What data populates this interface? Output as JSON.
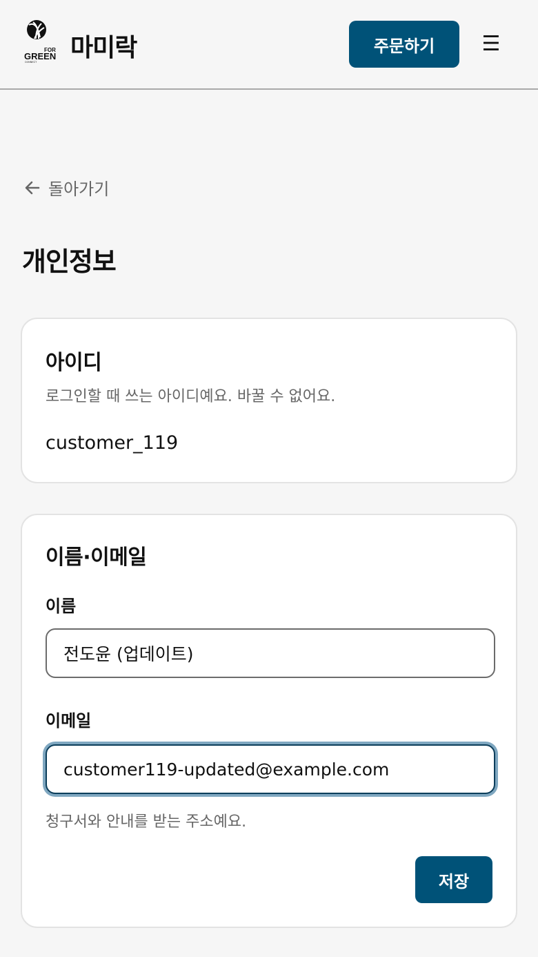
{
  "header": {
    "logo_text_for": "FOR",
    "logo_text_green": "GREEN",
    "logo_text_connect": "CONNECT",
    "brand_name": "마미락",
    "order_button_label": "주문하기",
    "menu_icon": "hamburger-menu-icon"
  },
  "nav": {
    "back_label": "돌아가기",
    "back_icon": "arrow-left-icon"
  },
  "page": {
    "title": "개인정보"
  },
  "id_card": {
    "title": "아이디",
    "description": "로그인할 때 쓰는 아이디예요. 바꿀 수 없어요.",
    "value": "customer_119"
  },
  "profile_card": {
    "title": "이름·이메일",
    "name_label": "이름",
    "name_value": "전도윤 (업데이트)",
    "email_label": "이메일",
    "email_value": "customer119-updated@example.com",
    "email_help": "청구서와 안내를 받는 주소예요.",
    "save_label": "저장"
  },
  "colors": {
    "primary": "#005278",
    "background": "#f6f6f6",
    "card": "#ffffff",
    "muted_text": "#666666",
    "focus_ring": "#7fa7c0"
  }
}
